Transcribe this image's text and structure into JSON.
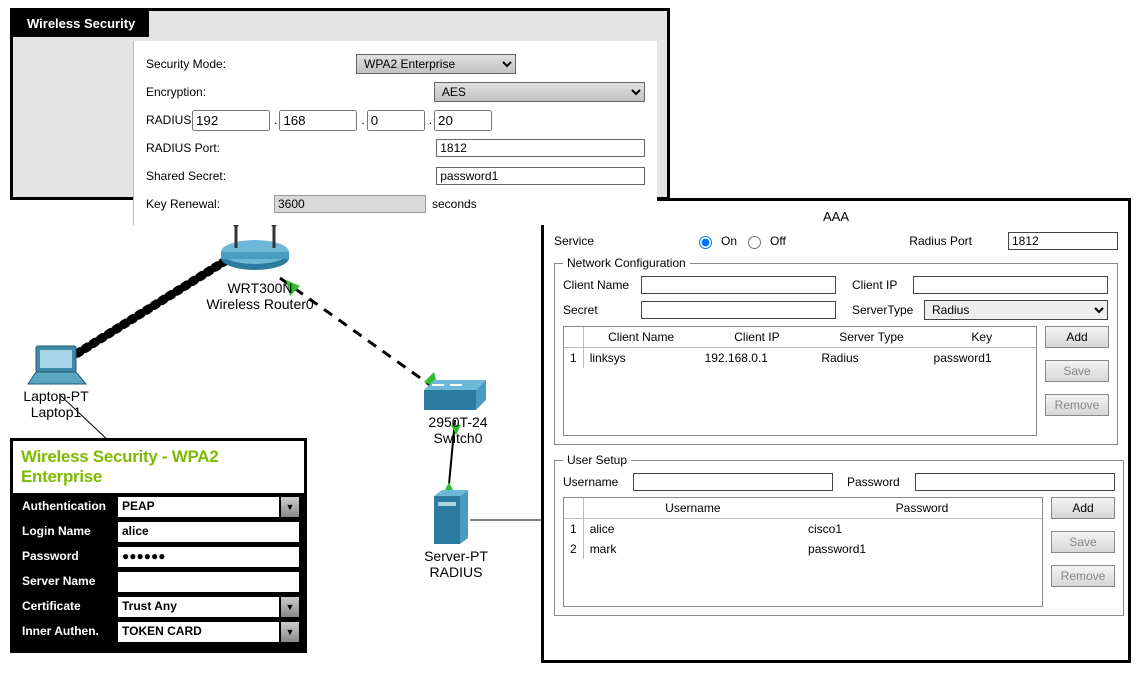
{
  "wireless": {
    "tab": "Wireless Security",
    "labels": {
      "mode": "Security Mode:",
      "enc": "Encryption:",
      "radius_server": "RADIUS Server:",
      "radius_port": "RADIUS Port:",
      "secret": "Shared Secret:",
      "renewal": "Key Renewal:",
      "seconds": "seconds"
    },
    "mode": "WPA2 Enterprise",
    "enc": "AES",
    "ip": [
      "192",
      "168",
      "0",
      "20"
    ],
    "port": "1812",
    "secret": "password1",
    "renewal": "3600"
  },
  "topology": {
    "router": "WRT300N\nWireless Router0",
    "laptop": "Laptop-PT\nLaptop1",
    "switch": "2950T-24\nSwitch0",
    "server": "Server-PT\nRADIUS"
  },
  "laptop": {
    "title": "Wireless Security - WPA2 Enterprise",
    "rows": [
      {
        "label": "Authentication",
        "value": "PEAP",
        "drop": true
      },
      {
        "label": "Login Name",
        "value": "alice",
        "drop": false
      },
      {
        "label": "Password",
        "value": "●●●●●●",
        "drop": false
      },
      {
        "label": "Server Name",
        "value": "",
        "drop": false
      },
      {
        "label": "Certificate",
        "value": "Trust Any",
        "drop": true
      },
      {
        "label": "Inner Authen.",
        "value": "TOKEN CARD",
        "drop": true
      }
    ]
  },
  "aaa": {
    "title": "AAA",
    "service_label": "Service",
    "on": "On",
    "off": "Off",
    "port_label": "Radius Port",
    "port": "1812",
    "netconf": {
      "legend": "Network Configuration",
      "client_name_label": "Client Name",
      "client_ip_label": "Client IP",
      "secret_label": "Secret",
      "servertype_label": "ServerType",
      "servertype": "Radius",
      "headers": [
        "Client Name",
        "Client IP",
        "Server Type",
        "Key"
      ],
      "rows": [
        {
          "idx": "1",
          "name": "linksys",
          "ip": "192.168.0.1",
          "type": "Radius",
          "key": "password1"
        }
      ]
    },
    "users": {
      "legend": "User Setup",
      "user_label": "Username",
      "pass_label": "Password",
      "headers": [
        "Username",
        "Password"
      ],
      "rows": [
        {
          "idx": "1",
          "user": "alice",
          "pass": "cisco1"
        },
        {
          "idx": "2",
          "user": "mark",
          "pass": "password1"
        }
      ]
    },
    "buttons": {
      "add": "Add",
      "save": "Save",
      "remove": "Remove"
    }
  }
}
